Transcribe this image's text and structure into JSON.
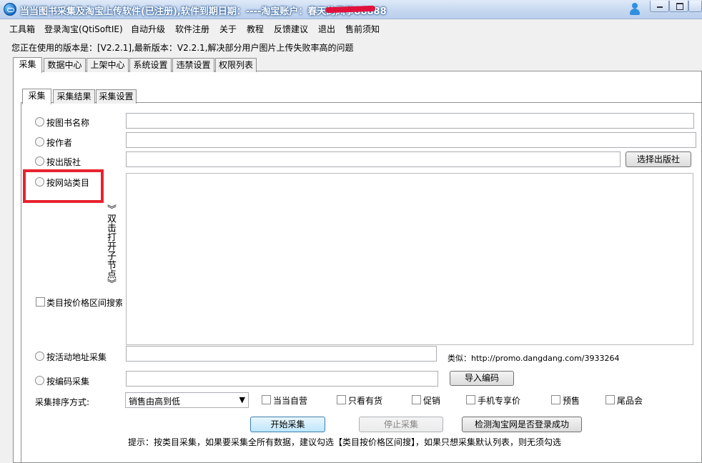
{
  "window": {
    "title": "当当图书采集及淘宝上传软件(已注册),软件到期日期：----淘宝账户：春天的风筝88888"
  },
  "menu": [
    "工具箱",
    "登录淘宝(QtiSoftIE)",
    "自动升级",
    "软件注册",
    "关于",
    "教程",
    "反馈建议",
    "退出",
    "售前须知"
  ],
  "version_line": "您正在使用的版本是：[V2.2.1],最新版本：V2.2.1,解决部分用户图片上传失败率高的问题",
  "main_tabs": [
    "采集",
    "数据中心",
    "上架中心",
    "系统设置",
    "违禁设置",
    "权限列表"
  ],
  "sub_tabs": [
    "采集",
    "采集结果",
    "采集设置"
  ],
  "form": {
    "by_title_label": "按图书名称",
    "by_title_value": "",
    "by_author_label": "按作者",
    "by_author_value": "",
    "by_publisher_label": "按出版社",
    "by_publisher_value": "",
    "select_publisher_button": "选择出版社",
    "by_category_label": "按网站类目",
    "double_click_hint": "》双击打开子节点》",
    "price_range_label": "类目按价格区间搜索",
    "by_activity_label": "按活动地址采集",
    "by_activity_value": "",
    "activity_example": "类似：http://promo.dangdang.com/3933264",
    "by_code_label": "按编码采集",
    "by_code_value": "",
    "import_code_button": "导入编码",
    "sort_label": "采集排序方式:",
    "sort_selected": "销售由高到低",
    "filters": [
      "当当自营",
      "只看有货",
      "促销",
      "手机专享价",
      "预售",
      "尾品会"
    ],
    "start_button": "开始采集",
    "stop_button": "停止采集",
    "check_login_button": "检测淘宝网是否登录成功",
    "tip": "提示：按类目采集，如果要采集全所有数据，建议勾选【类目按价格区间搜】，如果只想采集默认列表，则无须勾选"
  },
  "colors": {
    "highlight": "#e8232e",
    "redaction": "#e0123c"
  }
}
